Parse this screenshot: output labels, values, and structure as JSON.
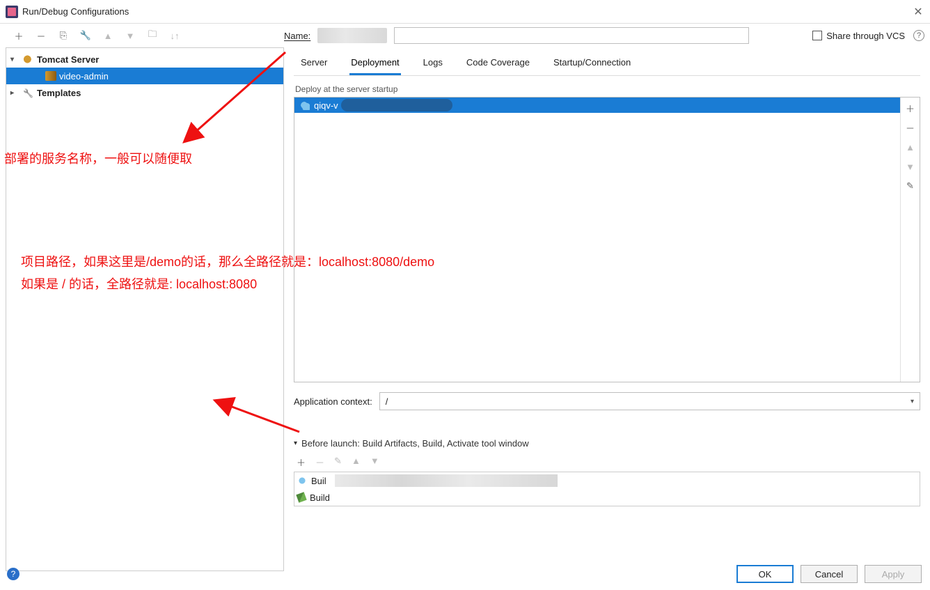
{
  "window": {
    "title": "Run/Debug Configurations"
  },
  "name_field": {
    "label": "Name:"
  },
  "share": {
    "label": "Share through VCS"
  },
  "tree": {
    "tomcat": "Tomcat Server",
    "config": "video-admin",
    "templates": "Templates"
  },
  "tabs": {
    "server": "Server",
    "deployment": "Deployment",
    "logs": "Logs",
    "coverage": "Code Coverage",
    "startup": "Startup/Connection"
  },
  "deploy": {
    "section": "Deploy at the server startup",
    "item_prefix": "qiqv-v"
  },
  "context": {
    "label": "Application context:",
    "value": "/"
  },
  "before": {
    "header": "Before launch: Build Artifacts, Build, Activate tool window",
    "row1": "Buil",
    "row2": "Build"
  },
  "buttons": {
    "ok": "OK",
    "cancel": "Cancel",
    "apply": "Apply"
  },
  "annotations": {
    "a1": "部署的服务名称，一般可以随便取",
    "a2_line1": "项目路径，如果这里是/demo的话，那么全路径就是：localhost:8080/demo",
    "a2_line2": "如果是 / 的话，全路径就是: localhost:8080"
  }
}
